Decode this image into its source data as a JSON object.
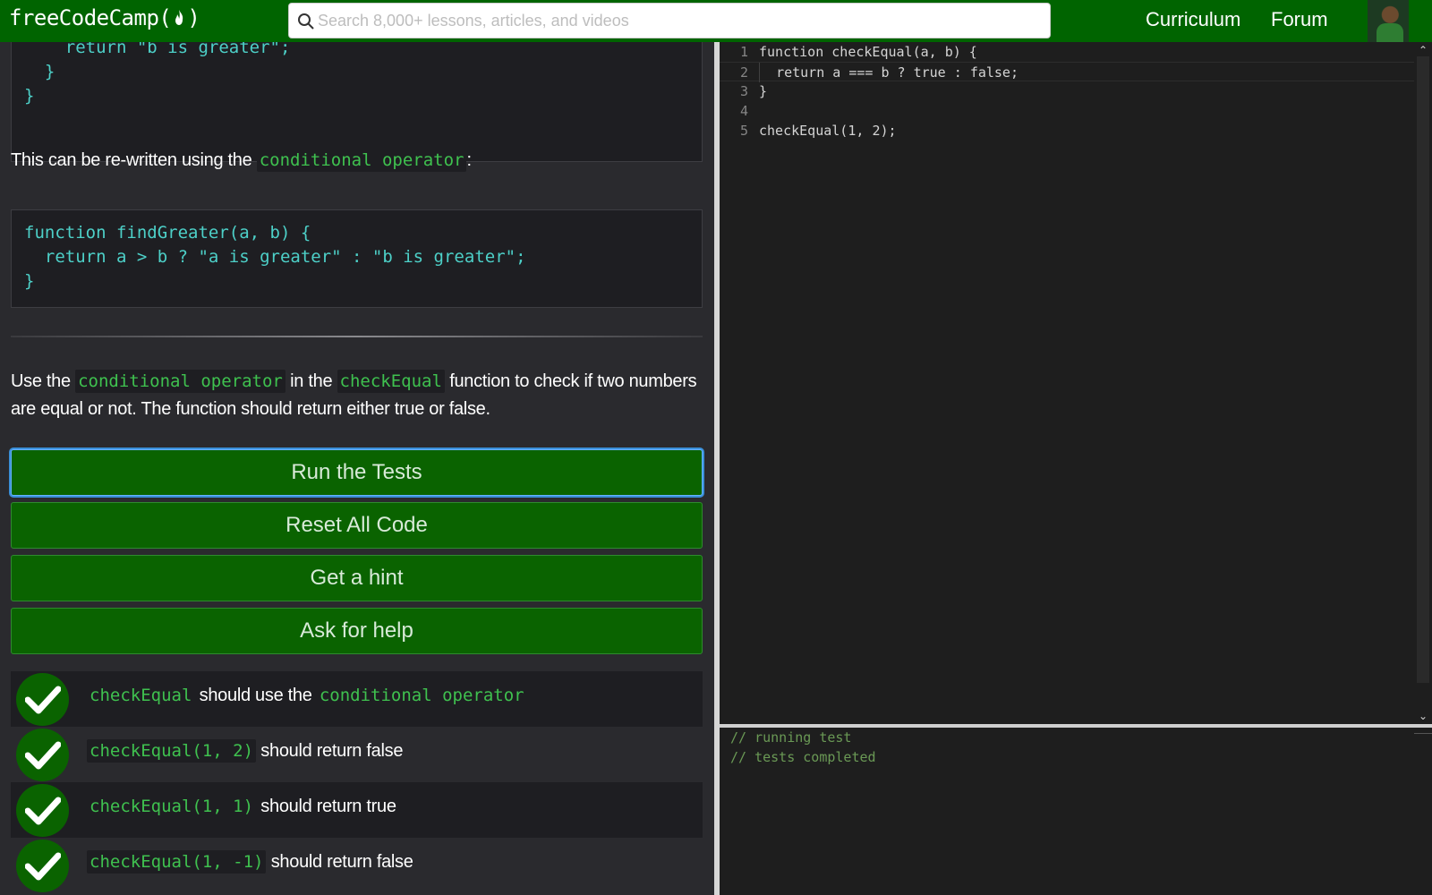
{
  "navbar": {
    "logo_text": "freeCodeCamp(",
    "logo_close": ")",
    "search_placeholder": "Search 8,000+ lessons, articles, and videos",
    "links": [
      "Curriculum",
      "Forum"
    ]
  },
  "lesson": {
    "code_top_lines": [
      "    return \"b is greater\";",
      "  }",
      "}"
    ],
    "intro_text": "This can be re-written using the",
    "intro_code": "conditional operator",
    "intro_suffix": ":",
    "code_mid_lines": [
      "function findGreater(a, b) {",
      "  return a > b ? \"a is greater\" : \"b is greater\";",
      "}"
    ],
    "task": {
      "part1": "Use the",
      "code1": "conditional operator",
      "part2": "in the",
      "code2": "checkEqual",
      "part3": "function to check if two numbers are equal or not. The function should return either true or false."
    }
  },
  "buttons": {
    "run": "Run the Tests",
    "reset": "Reset All Code",
    "hint": "Get a hint",
    "help": "Ask for help"
  },
  "tests": [
    {
      "code": "checkEqual",
      "text": "should use the",
      "code2": "conditional operator",
      "passed": true
    },
    {
      "code": "checkEqual(1, 2)",
      "text": "should return false",
      "passed": true
    },
    {
      "code": "checkEqual(1, 1)",
      "text": "should return true",
      "passed": true
    },
    {
      "code": "checkEqual(1, -1)",
      "text": "should return false",
      "passed": true
    }
  ],
  "editor": {
    "line_numbers": [
      "1",
      "2",
      "3",
      "4",
      "5"
    ],
    "l1_kw": "function",
    "l1_rest": " checkEqual(a, b) {",
    "l2_kw1": "return",
    "l2_mid": " a === b ? ",
    "l2_kw2": "true",
    "l2_colon": " : ",
    "l2_kw3": "false",
    "l2_end": ";",
    "l3": "}",
    "l5_pre": "checkEqual(",
    "l5_n1": "1",
    "l5_comma": ", ",
    "l5_n2": "2",
    "l5_end": ");"
  },
  "console": {
    "lines": [
      "// running test",
      "// tests completed"
    ]
  },
  "colors": {
    "brand_green": "#006400",
    "button_green": "#0a6300",
    "code_teal": "#4dd0c8",
    "inline_code_green": "#3fc14f"
  }
}
